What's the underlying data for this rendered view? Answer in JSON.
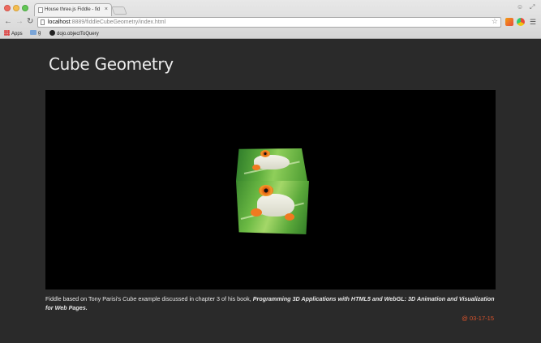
{
  "browser": {
    "tab_title": "House three.js Fiddle - fid",
    "tab_close": "×",
    "url_host": "localhost",
    "url_path": ":8889/fiddleCubeGeometry/index.html",
    "bookmarks": [
      {
        "label": "Apps",
        "icon": "apps-grid-icon"
      },
      {
        "label": "g",
        "icon": "folder-icon"
      },
      {
        "label": "dojo.objectToQuery",
        "icon": "dojo-icon"
      }
    ]
  },
  "page": {
    "title": "Cube Geometry",
    "caption_prefix": "Fiddle based on Tony Parisi's ",
    "caption_cube": "Cube",
    "caption_middle": " example discussed in chapter 3 of his book, ",
    "caption_book": "Programming 3D Applications with HTML5 and WebGL: 3D Animation and Visualization for Web Pages.",
    "date": "@ 03-17-15"
  },
  "colors": {
    "page_background": "#2a2a2a",
    "canvas_background": "#000000",
    "date_accent": "#d9532c"
  }
}
